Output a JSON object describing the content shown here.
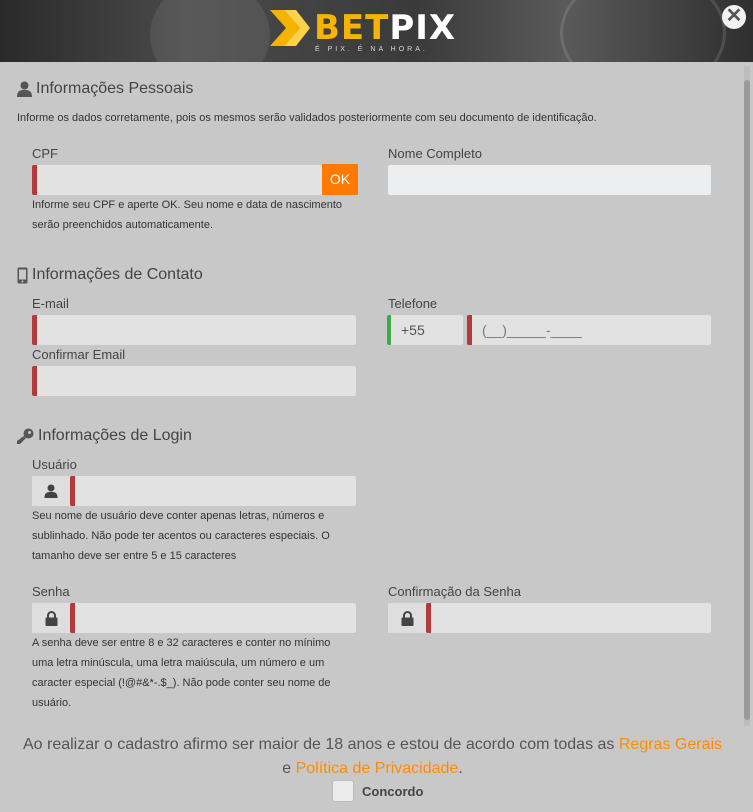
{
  "brand": {
    "name_part1": "BET",
    "name_part2": "PIX",
    "tagline": "É PIX. É NA HORA.",
    "accent_color": "#ff7a00",
    "logo_color": "#f6b400"
  },
  "close_icon": "close-icon",
  "personal": {
    "title": "Informações Pessoais",
    "icon": "user-icon",
    "note": "Informe os dados corretamente, pois os mesmos serão validados posteriormente com seu documento de identificação.",
    "cpf_label": "CPF",
    "cpf_value": "",
    "ok_label": "OK",
    "cpf_help": "Informe seu CPF e aperte OK. Seu nome e data de nascimento serão preenchidos automaticamente.",
    "name_label": "Nome Completo",
    "name_value": ""
  },
  "contact": {
    "title": "Informações de Contato",
    "icon": "mobile-icon",
    "email_label": "E-mail",
    "email_value": "",
    "confirm_email_label": "Confirmar Email",
    "confirm_email_value": "",
    "phone_label": "Telefone",
    "phone_code": "+55",
    "phone_placeholder": "(__)_____-____"
  },
  "login": {
    "title": "Informações de Login",
    "icon": "key-icon",
    "user_label": "Usuário",
    "user_value": "",
    "user_help": "Seu nome de usuário deve conter apenas letras, números e sublinhado. Não pode ter acentos ou caracteres especiais. O tamanho deve ser entre 5 e 15 caracteres",
    "password_label": "Senha",
    "password_value": "",
    "password_help": "A senha deve ser entre 8 e 32 caracteres e conter no mínimo uma letra minúscula, uma letra maiúscula, um número e um caracter especial (!@#&*-.$_). Não pode conter seu nome de usuário.",
    "password_confirm_label": "Confirmação da Senha",
    "password_confirm_value": ""
  },
  "footer": {
    "text_before": "Ao realizar o cadastro afirmo ser maior de 18 anos e estou de acordo com todas as ",
    "link_rules": "Regras Gerais",
    "text_and": "e ",
    "link_privacy": "Política de Privacidade",
    "text_end": ".",
    "agree_label": "Concordo"
  }
}
